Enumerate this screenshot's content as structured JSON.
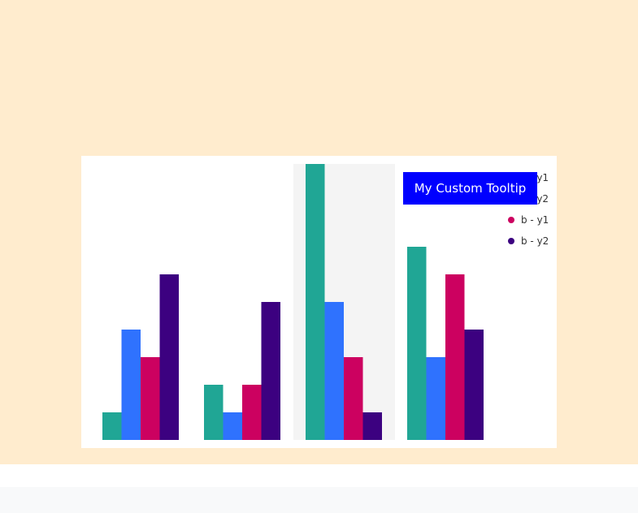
{
  "tooltip": {
    "text": "My Custom Tooltip"
  },
  "chart_data": {
    "type": "bar",
    "categories": [
      "",
      "",
      "",
      ""
    ],
    "series": [
      {
        "name": "a - y1",
        "color": "#20a695",
        "values": [
          1,
          2,
          10,
          7
        ]
      },
      {
        "name": "a - y2",
        "color": "#2f72fe",
        "values": [
          4,
          1,
          5,
          3
        ]
      },
      {
        "name": "b - y1",
        "color": "#cc0160",
        "values": [
          3,
          2,
          3,
          6
        ]
      },
      {
        "name": "b - y2",
        "color": "#3c0180",
        "values": [
          6,
          5,
          1,
          4
        ]
      }
    ],
    "ylim": [
      0,
      10
    ],
    "highlighted_category_index": 2,
    "grid": false,
    "legend_placement": "top-right",
    "title": "",
    "xlabel": "",
    "ylabel": ""
  }
}
